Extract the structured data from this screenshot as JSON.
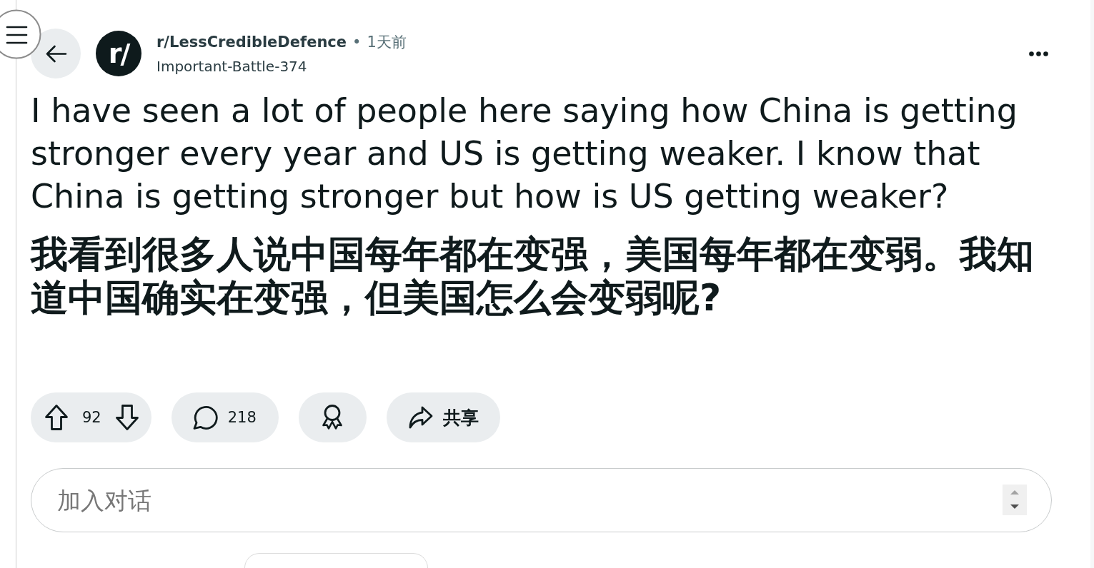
{
  "post": {
    "avatar_text": "r/",
    "subreddit": "r/LessCredibleDefence",
    "separator": "•",
    "time": "1天前",
    "author": "Important-Battle-374",
    "title": "I have seen a lot of people here saying how China is getting stronger every year and US is getting weaker. I know that China is getting stronger but how is US getting weaker?",
    "title_translation": "我看到很多人说中国每年都在变强，美国每年都在变弱。我知道中国确实在变强，但美国怎么会变弱呢?"
  },
  "actions": [
    {
      "kind": "vote",
      "score": "92"
    },
    {
      "kind": "comments",
      "count": "218"
    },
    {
      "kind": "award"
    },
    {
      "kind": "share",
      "label": "共享"
    }
  ],
  "comment_box": {
    "placeholder": "加入对话"
  }
}
